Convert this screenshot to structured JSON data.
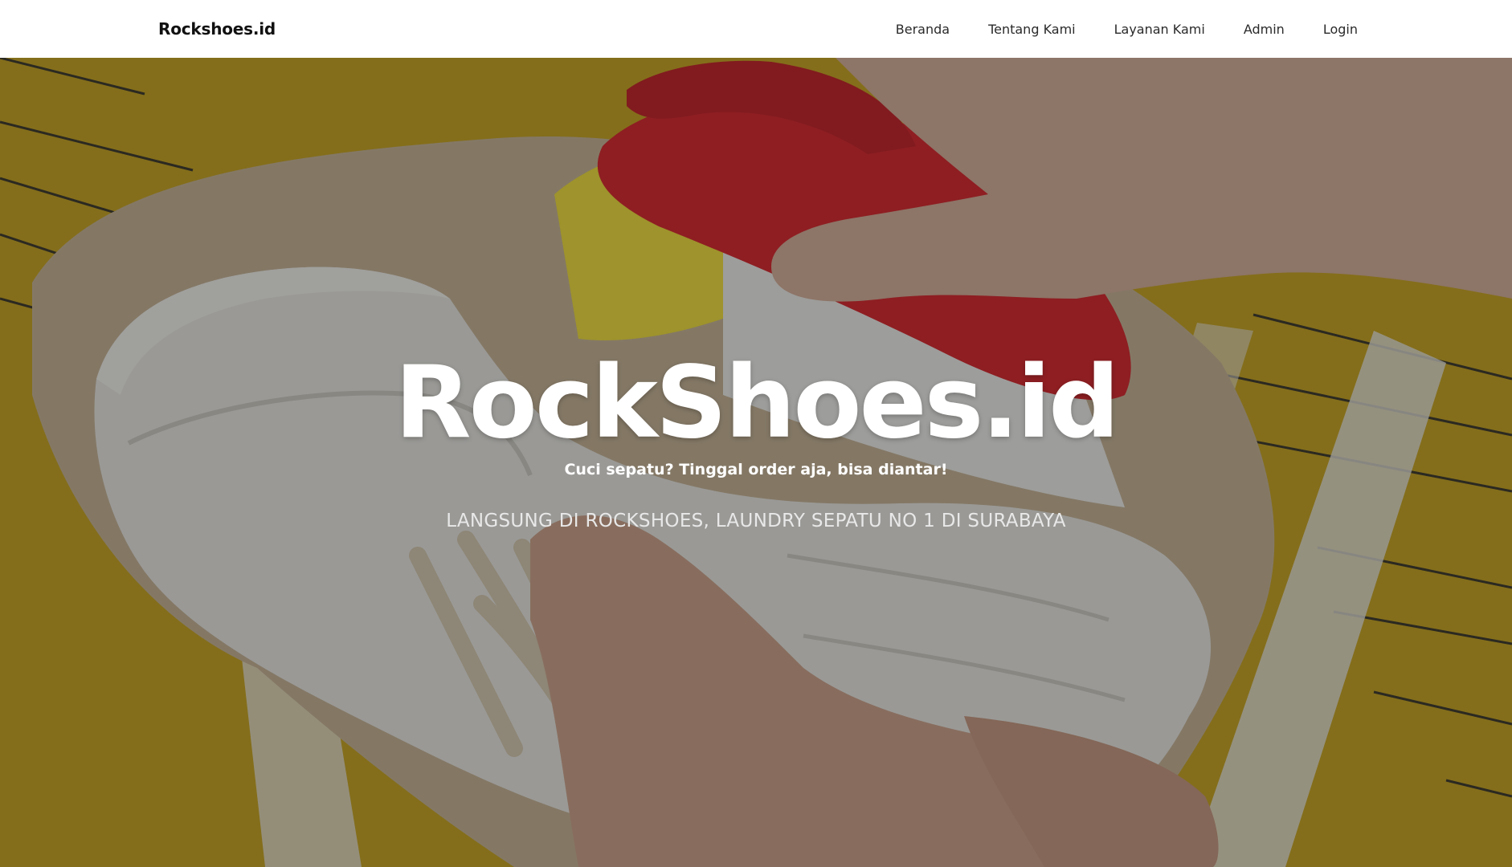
{
  "navbar": {
    "brand": "Rockshoes.id",
    "links": [
      {
        "label": "Beranda"
      },
      {
        "label": "Tentang Kami"
      },
      {
        "label": "Layanan Kami"
      },
      {
        "label": "Admin"
      },
      {
        "label": "Login"
      }
    ]
  },
  "hero": {
    "title": "RockShoes.id",
    "tagline": "Cuci sepatu? Tinggal order aja, bisa diantar!",
    "subtitle": "LANGSUNG DI ROCKSHOES, LAUNDRY SEPATU NO 1 DI SURABAYA"
  },
  "colors": {
    "navbar_bg": "#ffffff",
    "hero_yellow": "#c9a520",
    "overlay": "rgba(20,20,20,0.38)",
    "brush_red": "#d8252b",
    "bristle_yellow": "#f2e03a",
    "shoe_white": "#ecebe6"
  }
}
